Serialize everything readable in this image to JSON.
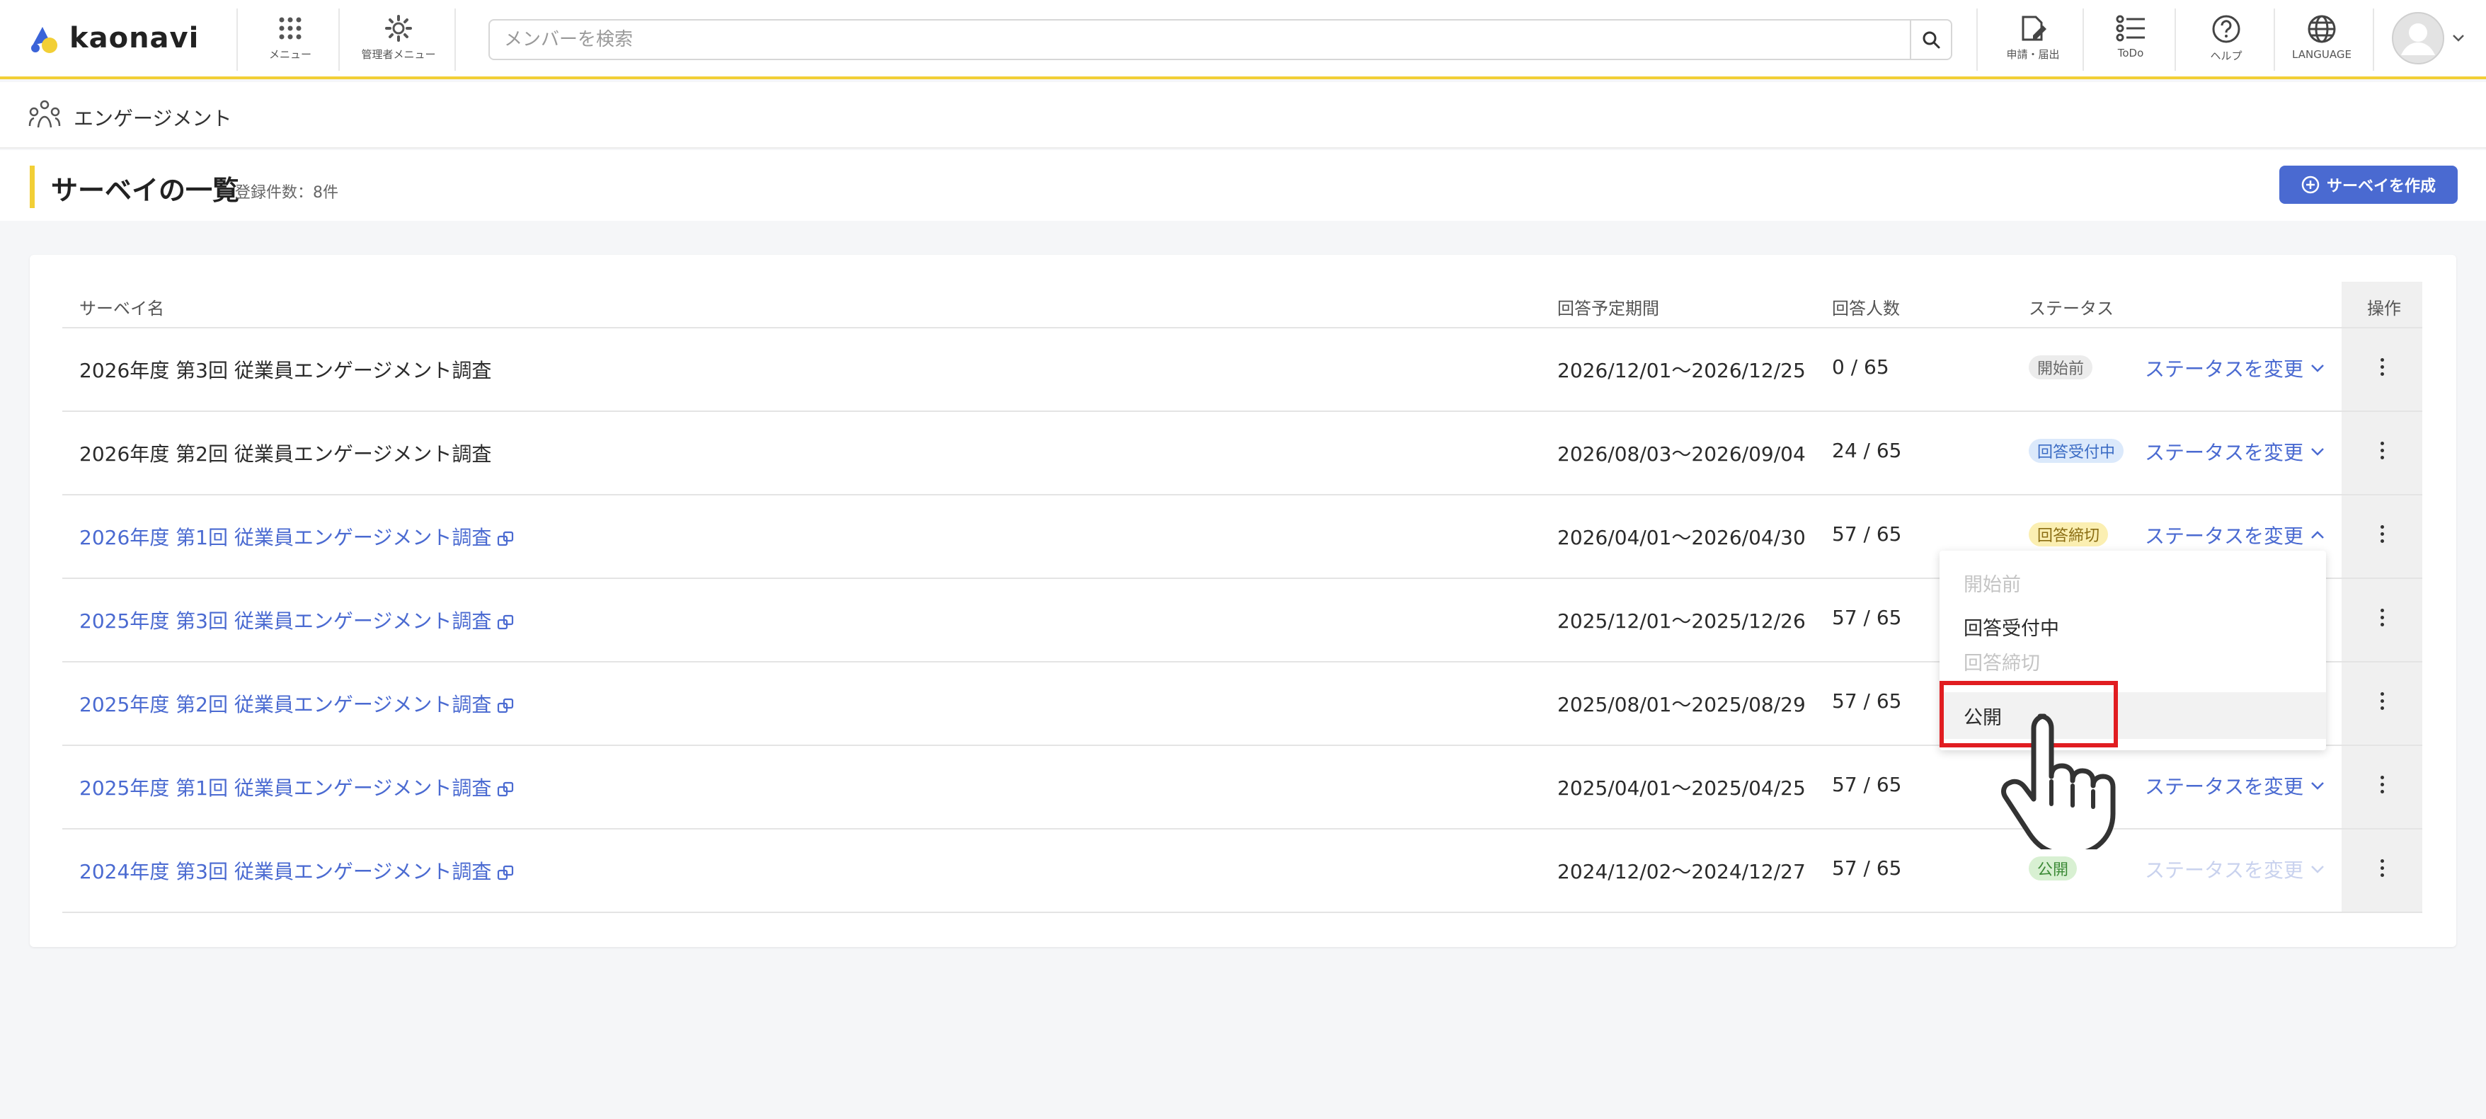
{
  "header": {
    "logo_text": "kaonavi",
    "nav": [
      {
        "label": "メニュー",
        "icon": "grid-icon"
      },
      {
        "label": "管理者メニュー",
        "icon": "gear-icon"
      }
    ],
    "search": {
      "placeholder": "メンバーを検索",
      "value": ""
    },
    "right_nav": [
      {
        "label": "申請・届出",
        "icon": "document-pen-icon"
      },
      {
        "label": "ToDo",
        "icon": "checklist-icon"
      },
      {
        "label": "ヘルプ",
        "icon": "help-circle-icon"
      },
      {
        "label": "LANGUAGE",
        "icon": "globe-icon"
      }
    ]
  },
  "breadcrumb": {
    "label": "エンゲージメント",
    "icon": "people-icon"
  },
  "page": {
    "title": "サーベイの一覧",
    "record_count": "登録件数：8件",
    "create_button": "サーベイを作成"
  },
  "table": {
    "headers": {
      "name": "サーベイ名",
      "period": "回答予定期間",
      "respondents": "回答人数",
      "status": "ステータス",
      "ops": "操作"
    },
    "rows": [
      {
        "name": "2026年度 第3回 従業員エンゲージメント調査",
        "period": "2026/12/01〜2026/12/25",
        "respondents": "0 / 65",
        "status": "開始前",
        "change": "ステータスを変更"
      },
      {
        "name": "2026年度 第2回 従業員エンゲージメント調査",
        "period": "2026/08/03〜2026/09/04",
        "respondents": "24 / 65",
        "status": "回答受付中",
        "change": "ステータスを変更"
      },
      {
        "name": "2026年度 第1回 従業員エンゲージメント調査",
        "period": "2026/04/01〜2026/04/30",
        "respondents": "57 / 65",
        "status": "回答締切",
        "change": "ステータスを変更"
      },
      {
        "name": "2025年度 第3回 従業員エンゲージメント調査",
        "period": "2025/12/01〜2025/12/26",
        "respondents": "57 / 65",
        "status": "",
        "change": ""
      },
      {
        "name": "2025年度 第2回 従業員エンゲージメント調査",
        "period": "2025/08/01〜2025/08/29",
        "respondents": "57 / 65",
        "status": "",
        "change": ""
      },
      {
        "name": "2025年度 第1回 従業員エンゲージメント調査",
        "period": "2025/04/01〜2025/04/25",
        "respondents": "57 / 65",
        "status": "",
        "change": "ステータスを変更"
      },
      {
        "name": "2024年度 第3回 従業員エンゲージメント調査",
        "period": "2024/12/02〜2024/12/27",
        "respondents": "57 / 65",
        "status": "公開",
        "change": "ステータスを変更"
      }
    ]
  },
  "dropdown": {
    "items": [
      {
        "label": "開始前",
        "enabled": false
      },
      {
        "label": "回答受付中",
        "enabled": true
      },
      {
        "label": "回答締切",
        "enabled": false
      },
      {
        "label": "公開",
        "enabled": true
      }
    ]
  },
  "colors": {
    "accent": "#4a6ad1",
    "brand_yellow": "#f2cf36",
    "highlight_red": "#e11d21"
  }
}
